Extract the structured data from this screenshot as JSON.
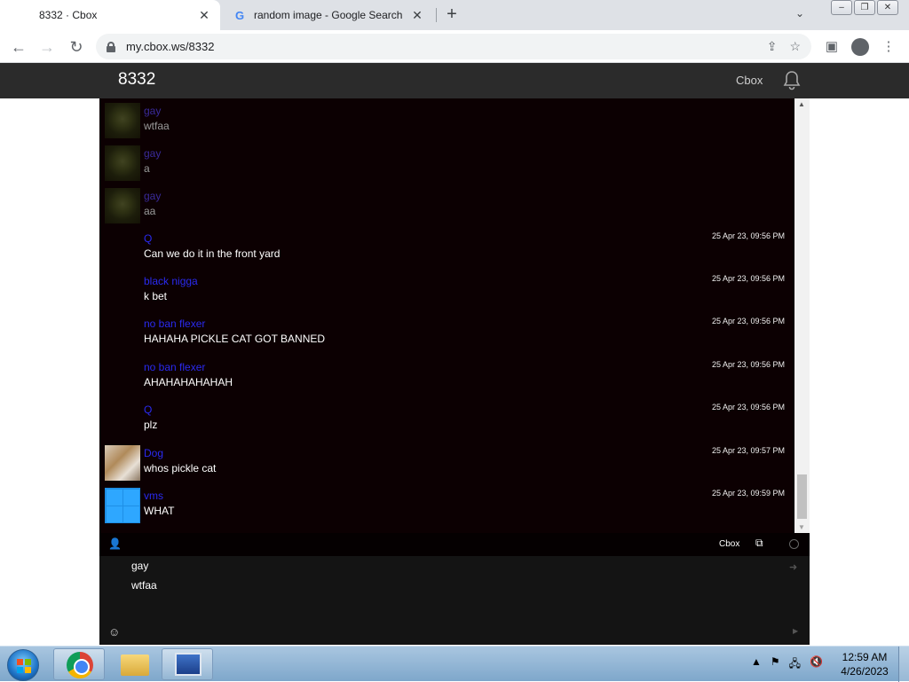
{
  "browser": {
    "tabs": [
      {
        "title": "8332 · Cbox",
        "active": true
      },
      {
        "title": "random image - Google Search",
        "active": false
      }
    ],
    "url": "my.cbox.ws/8332"
  },
  "page": {
    "title": "8332",
    "brand_link": "Cbox"
  },
  "messages": [
    {
      "name": "gay",
      "text": "wtfaa",
      "timestamp": "",
      "avatar": "shrek-avatar"
    },
    {
      "name": "gay",
      "text": "a",
      "timestamp": "",
      "avatar": "shrek-avatar"
    },
    {
      "name": "gay",
      "text": "aa",
      "timestamp": "",
      "avatar": "shrek-avatar"
    },
    {
      "name": "Q",
      "text": "Can we do it in the front yard",
      "timestamp": "25 Apr 23, 09:56 PM",
      "avatar": ""
    },
    {
      "name": "black nigga",
      "text": "k bet",
      "timestamp": "25 Apr 23, 09:56 PM",
      "avatar": ""
    },
    {
      "name": "no ban flexer",
      "text": "HAHAHA PICKLE CAT GOT BANNED",
      "timestamp": "25 Apr 23, 09:56 PM",
      "avatar": ""
    },
    {
      "name": "no ban flexer",
      "text": "AHAHAHAHAHAH",
      "timestamp": "25 Apr 23, 09:56 PM",
      "avatar": ""
    },
    {
      "name": "Q",
      "text": "plz",
      "timestamp": "25 Apr 23, 09:56 PM",
      "avatar": ""
    },
    {
      "name": "Dog",
      "text": "whos pickle cat",
      "timestamp": "25 Apr 23, 09:57 PM",
      "avatar": "dog-avatar"
    },
    {
      "name": "vms",
      "text": "WHAT",
      "timestamp": "25 Apr 23, 09:59 PM",
      "avatar": "windows-avatar"
    }
  ],
  "footer": {
    "brand": "Cbox"
  },
  "input": {
    "lines": [
      "gay",
      "wtfaa"
    ]
  },
  "taskbar": {
    "time": "12:59 AM",
    "date": "4/26/2023"
  },
  "colors": {
    "accent_name": "#2a2af0",
    "chat_bg": "#0c0002",
    "header_bg": "#2b2b2b"
  }
}
